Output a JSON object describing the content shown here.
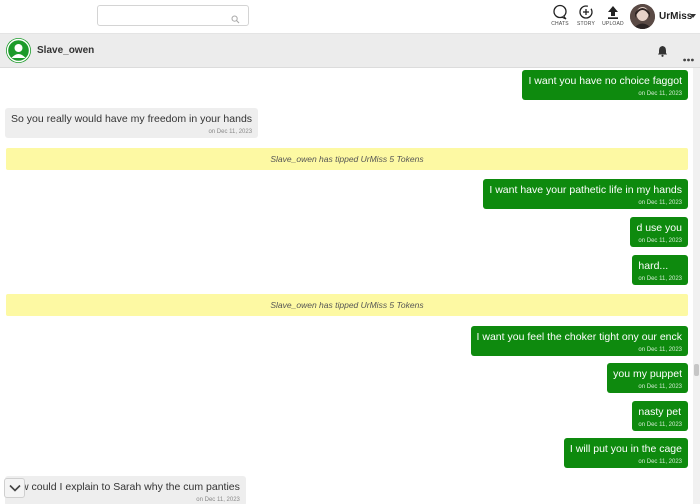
{
  "topbar": {
    "search": {
      "value": "",
      "placeholder": ""
    },
    "tools": [
      {
        "label": "CHATS",
        "icon": "chat-bubble-icon"
      },
      {
        "label": "STORY",
        "icon": "story-plus-icon"
      },
      {
        "label": "UPLOAD",
        "icon": "upload-icon"
      }
    ],
    "username": "UrMiss"
  },
  "chat": {
    "contact_name": "Slave_owen"
  },
  "messages": [
    {
      "direction": "out",
      "text": "I want you have no choice faggot",
      "time": "on Dec 11, 2023"
    },
    {
      "direction": "in",
      "text": "So you really would have my freedom in your hands",
      "time": "on Dec 11, 2023"
    },
    {
      "direction": "tip",
      "text": "Slave_owen has tipped UrMiss 5 Tokens"
    },
    {
      "direction": "out",
      "text": "I want have your pathetic life in my hands",
      "time": "on Dec 11, 2023"
    },
    {
      "direction": "out",
      "text": "d use you",
      "time": "on Dec 11, 2023"
    },
    {
      "direction": "out",
      "text": "hard...",
      "time": "on Dec 11, 2023"
    },
    {
      "direction": "tip",
      "text": "Slave_owen has tipped UrMiss 5 Tokens"
    },
    {
      "direction": "out",
      "text": "I want you feel the choker tight ony our enck",
      "time": "on Dec 11, 2023"
    },
    {
      "direction": "out",
      "text": "you my puppet",
      "time": "on Dec 11, 2023"
    },
    {
      "direction": "out",
      "text": "nasty pet",
      "time": "on Dec 11, 2023"
    },
    {
      "direction": "out",
      "text": "I will put you in the cage",
      "time": "on Dec 11, 2023"
    },
    {
      "direction": "in",
      "text": "w could I explain to Sarah why the cum panties",
      "time": "on Dec 11, 2023"
    }
  ],
  "colors": {
    "outgoing_bubble": "#0e8a0e",
    "incoming_bubble": "#eeeeee",
    "tip_banner": "#fdf9a3"
  }
}
